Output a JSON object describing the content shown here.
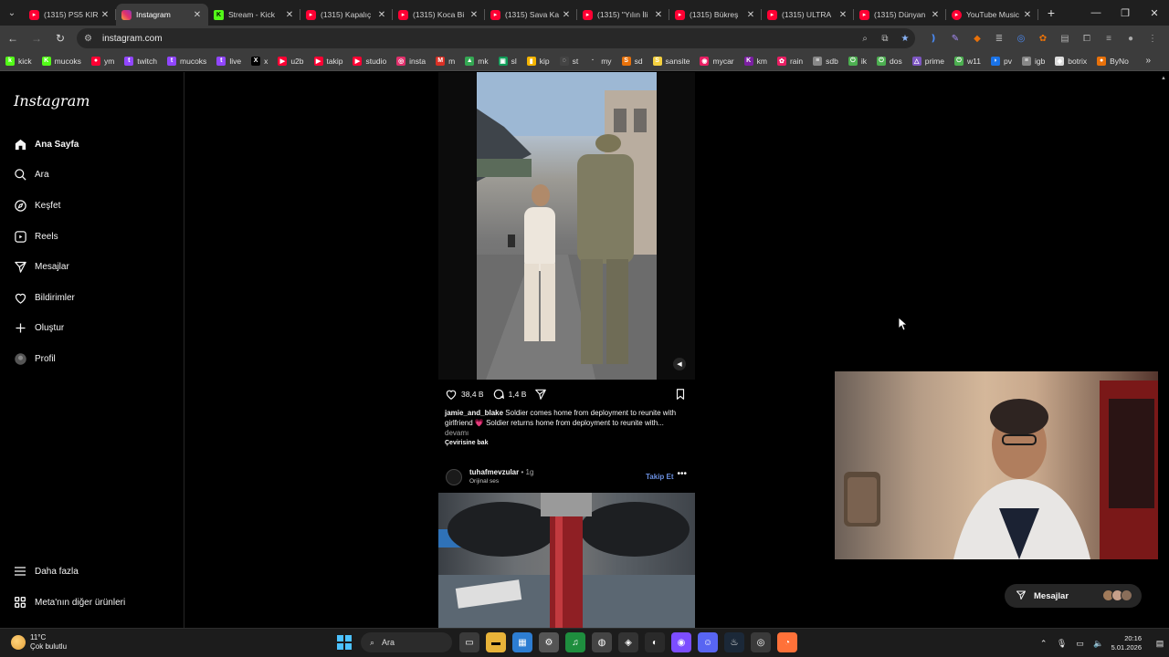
{
  "browser": {
    "tabs": [
      {
        "title": "(1315) PS5 KIR",
        "favicon": "youtube-icon",
        "active": false
      },
      {
        "title": "Instagram",
        "favicon": "instagram-icon",
        "active": true
      },
      {
        "title": "Stream - Kick",
        "favicon": "kick-icon",
        "active": false
      },
      {
        "title": "(1315) Kapalıç",
        "favicon": "youtube-icon",
        "active": false
      },
      {
        "title": "(1315) Koca Bi",
        "favicon": "youtube-icon",
        "active": false
      },
      {
        "title": "(1315) Sava Ka",
        "favicon": "youtube-icon",
        "active": false
      },
      {
        "title": "(1315) \"Yılın İli",
        "favicon": "youtube-icon",
        "active": false
      },
      {
        "title": "(1315) Bükreş",
        "favicon": "youtube-icon",
        "active": false
      },
      {
        "title": "(1315) ULTRA",
        "favicon": "youtube-icon",
        "active": false
      },
      {
        "title": "(1315) Dünyan",
        "favicon": "youtube-icon",
        "active": false
      },
      {
        "title": "YouTube Music",
        "favicon": "youtube-music-icon",
        "active": false
      }
    ],
    "url": "instagram.com",
    "bookmarks": [
      {
        "label": "kick",
        "color": "#53fc18",
        "glyph": "k"
      },
      {
        "label": "mucoks",
        "color": "#53fc18",
        "glyph": "K"
      },
      {
        "label": "ym",
        "color": "#ff0033",
        "glyph": "●"
      },
      {
        "label": "twitch",
        "color": "#9146ff",
        "glyph": "t"
      },
      {
        "label": "mucoks",
        "color": "#9146ff",
        "glyph": "t"
      },
      {
        "label": "live",
        "color": "#9146ff",
        "glyph": "t"
      },
      {
        "label": "x",
        "color": "#000000",
        "glyph": "X"
      },
      {
        "label": "u2b",
        "color": "#ff0033",
        "glyph": "▶"
      },
      {
        "label": "takip",
        "color": "#ff0033",
        "glyph": "▶"
      },
      {
        "label": "studio",
        "color": "#ff0033",
        "glyph": "▶"
      },
      {
        "label": "insta",
        "color": "#e1306c",
        "glyph": "◎"
      },
      {
        "label": "m",
        "color": "#d93025",
        "glyph": "M"
      },
      {
        "label": "mk",
        "color": "#34a853",
        "glyph": "▲"
      },
      {
        "label": "sl",
        "color": "#0f9d58",
        "glyph": "▣"
      },
      {
        "label": "kip",
        "color": "#f4b400",
        "glyph": "▮"
      },
      {
        "label": "st",
        "color": "#444444",
        "glyph": "◌"
      },
      {
        "label": "my",
        "color": "#3c3c3c",
        "glyph": "·"
      },
      {
        "label": "sd",
        "color": "#e8710a",
        "glyph": "S"
      },
      {
        "label": "sansite",
        "color": "#f4d03f",
        "glyph": "S"
      },
      {
        "label": "mycar",
        "color": "#e91e63",
        "glyph": "◉"
      },
      {
        "label": "km",
        "color": "#7b1fa2",
        "glyph": "K"
      },
      {
        "label": "rain",
        "color": "#e91e63",
        "glyph": "✿"
      },
      {
        "label": "sdb",
        "color": "#888888",
        "glyph": "≡"
      },
      {
        "label": "ik",
        "color": "#4caf50",
        "glyph": "⏻"
      },
      {
        "label": "dos",
        "color": "#4caf50",
        "glyph": "⏻"
      },
      {
        "label": "prime",
        "color": "#7e57c2",
        "glyph": "△"
      },
      {
        "label": "w11",
        "color": "#4caf50",
        "glyph": "⏻"
      },
      {
        "label": "pv",
        "color": "#1a73e8",
        "glyph": "◗"
      },
      {
        "label": "igb",
        "color": "#888888",
        "glyph": "≡"
      },
      {
        "label": "botrix",
        "color": "#dddddd",
        "glyph": "◆"
      },
      {
        "label": "ByNo",
        "color": "#e8710a",
        "glyph": "●"
      }
    ]
  },
  "instagram": {
    "logo": "Instagram",
    "nav": [
      {
        "label": "Ana Sayfa",
        "icon": "home-icon"
      },
      {
        "label": "Ara",
        "icon": "search-icon"
      },
      {
        "label": "Keşfet",
        "icon": "compass-icon"
      },
      {
        "label": "Reels",
        "icon": "reels-icon"
      },
      {
        "label": "Mesajlar",
        "icon": "messages-icon"
      },
      {
        "label": "Bildirimler",
        "icon": "heart-icon"
      },
      {
        "label": "Oluştur",
        "icon": "plus-icon"
      },
      {
        "label": "Profil",
        "icon": "profile-avatar-icon"
      }
    ],
    "bottom_nav": [
      {
        "label": "Daha fazla",
        "icon": "menu-icon"
      },
      {
        "label": "Meta'nın diğer ürünleri",
        "icon": "meta-grid-icon"
      }
    ],
    "post1": {
      "likes": "38,4 B",
      "comments": "1,4 B",
      "username": "jamie_and_blake",
      "caption": "Soldier comes home from deployment to reunite with girlfriend 💗 Soldier returns home from deployment to reunite with...",
      "more": "devamı",
      "translate": "Çevirisine bak"
    },
    "post2": {
      "username": "tuhafmevzular",
      "separator": "•",
      "age": "1g",
      "audio": "Orijinal ses",
      "follow": "Takip Et"
    },
    "messages_pill": "Mesajlar"
  },
  "taskbar": {
    "weather_temp": "11°C",
    "weather_desc": "Çok bulutlu",
    "search": "Ara",
    "time": "20:16",
    "date": "5.01.2026"
  }
}
